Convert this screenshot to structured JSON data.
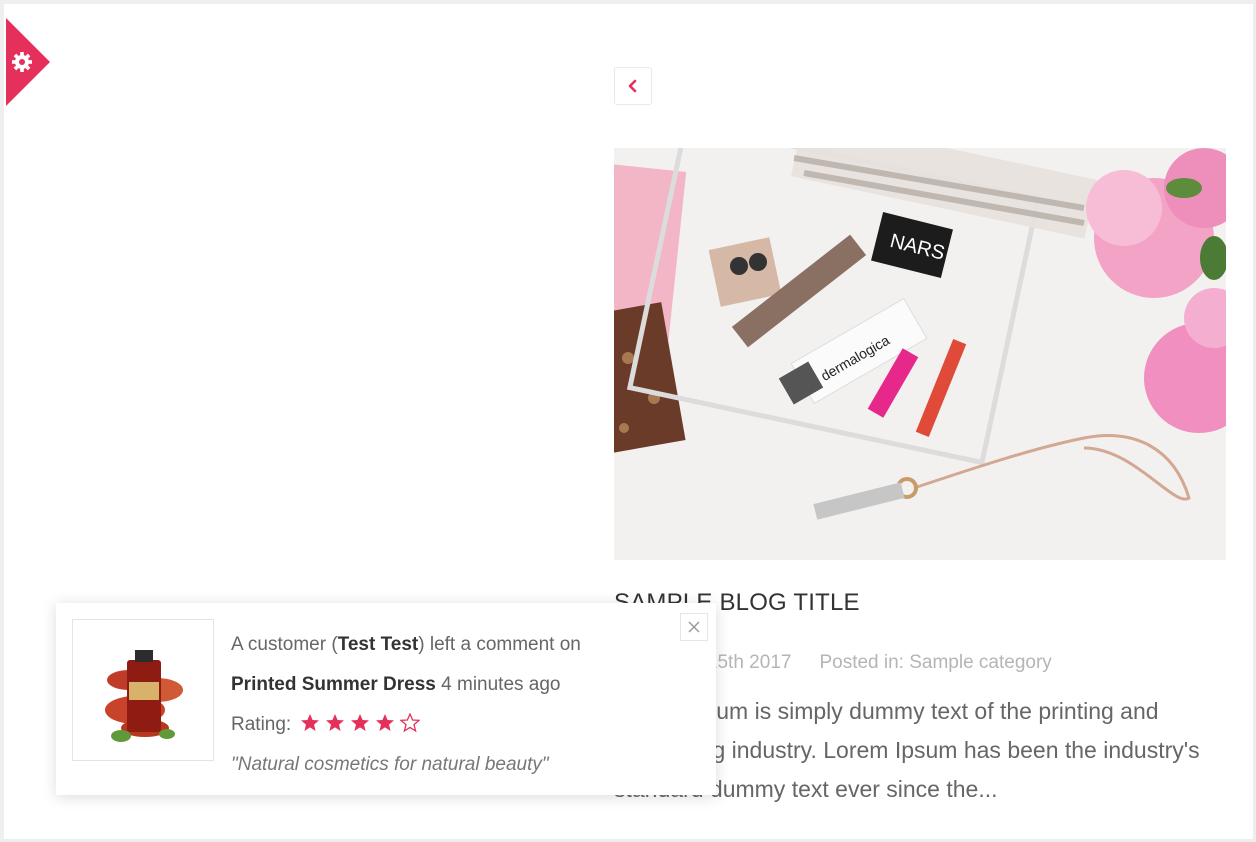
{
  "theme": {
    "accent": "#e4305b"
  },
  "settings_tab": {
    "icon": "gear-icon"
  },
  "nav": {
    "back_icon": "chevron-left-icon"
  },
  "post": {
    "title": "SAMPLE BLOG TITLE",
    "date": "December 15th 2017",
    "posted_in_label": "Posted in:",
    "category": "Sample category",
    "excerpt": "Lorem Ipsum is simply dummy text of the printing and typesetting industry. Lorem Ipsum has been the industry's standard dummy text ever since the..."
  },
  "notification": {
    "prefix": "A customer (",
    "customer": "Test Test",
    "suffix": ") left a comment on",
    "product": "Printed Summer Dress",
    "time": "4 minutes ago",
    "rating_label": "Rating:",
    "rating": 4,
    "rating_max": 5,
    "comment": "\"Natural cosmetics for natural beauty\"",
    "close_icon": "close-icon"
  }
}
